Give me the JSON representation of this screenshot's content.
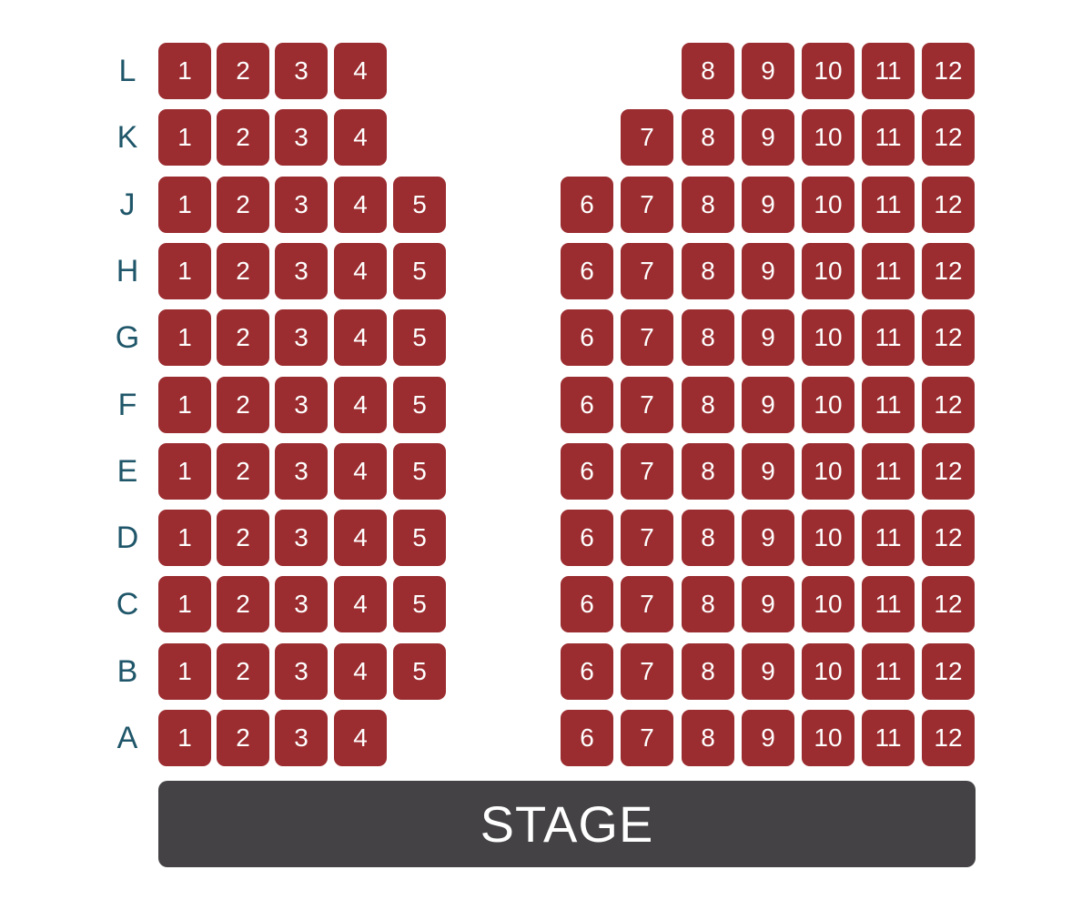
{
  "colors": {
    "seat": "#9b2c2f",
    "seat_text": "#ffffff",
    "row_label": "#1f5669",
    "stage": "#444244",
    "stage_text": "#ffffff"
  },
  "stage": {
    "label": "STAGE"
  },
  "rows": [
    {
      "label": "L",
      "seats": [
        "1",
        "2",
        "3",
        "4",
        "8",
        "9",
        "10",
        "11",
        "12"
      ]
    },
    {
      "label": "K",
      "seats": [
        "1",
        "2",
        "3",
        "4",
        "7",
        "8",
        "9",
        "10",
        "11",
        "12"
      ]
    },
    {
      "label": "J",
      "seats": [
        "1",
        "2",
        "3",
        "4",
        "5",
        "6",
        "7",
        "8",
        "9",
        "10",
        "11",
        "12"
      ]
    },
    {
      "label": "H",
      "seats": [
        "1",
        "2",
        "3",
        "4",
        "5",
        "6",
        "7",
        "8",
        "9",
        "10",
        "11",
        "12"
      ]
    },
    {
      "label": "G",
      "seats": [
        "1",
        "2",
        "3",
        "4",
        "5",
        "6",
        "7",
        "8",
        "9",
        "10",
        "11",
        "12"
      ]
    },
    {
      "label": "F",
      "seats": [
        "1",
        "2",
        "3",
        "4",
        "5",
        "6",
        "7",
        "8",
        "9",
        "10",
        "11",
        "12"
      ]
    },
    {
      "label": "E",
      "seats": [
        "1",
        "2",
        "3",
        "4",
        "5",
        "6",
        "7",
        "8",
        "9",
        "10",
        "11",
        "12"
      ]
    },
    {
      "label": "D",
      "seats": [
        "1",
        "2",
        "3",
        "4",
        "5",
        "6",
        "7",
        "8",
        "9",
        "10",
        "11",
        "12"
      ]
    },
    {
      "label": "C",
      "seats": [
        "1",
        "2",
        "3",
        "4",
        "5",
        "6",
        "7",
        "8",
        "9",
        "10",
        "11",
        "12"
      ]
    },
    {
      "label": "B",
      "seats": [
        "1",
        "2",
        "3",
        "4",
        "5",
        "6",
        "7",
        "8",
        "9",
        "10",
        "11",
        "12"
      ]
    },
    {
      "label": "A",
      "seats": [
        "1",
        "2",
        "3",
        "4",
        "6",
        "7",
        "8",
        "9",
        "10",
        "11",
        "12"
      ]
    }
  ]
}
